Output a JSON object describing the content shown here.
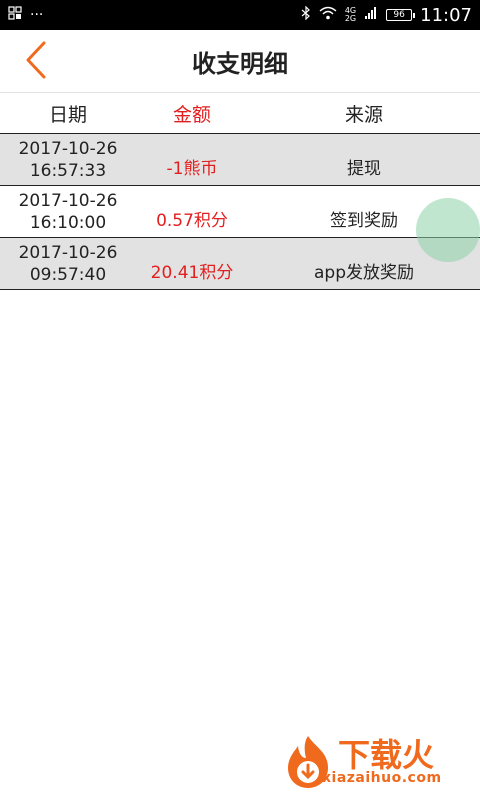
{
  "status_bar": {
    "time": "11:07",
    "battery": "96",
    "network_top": "4G",
    "network_bottom": "2G",
    "left_dots": "···"
  },
  "header": {
    "title": "收支明细"
  },
  "table": {
    "columns": {
      "date": "日期",
      "amount": "金额",
      "source": "来源"
    },
    "rows": [
      {
        "date": "2017-10-26",
        "time": "16:57:33",
        "amount": "-1熊币",
        "source": "提现"
      },
      {
        "date": "2017-10-26",
        "time": "16:10:00",
        "amount": "0.57积分",
        "source": "签到奖励"
      },
      {
        "date": "2017-10-26",
        "time": "09:57:40",
        "amount": "20.41积分",
        "source": "app发放奖励"
      }
    ]
  },
  "watermark": {
    "title": "下载火",
    "url": "xiazaihuo.com"
  },
  "colors": {
    "accent": "#f06a1e",
    "amount": "#e31e1e",
    "row_alt": "#e2e2e2"
  }
}
